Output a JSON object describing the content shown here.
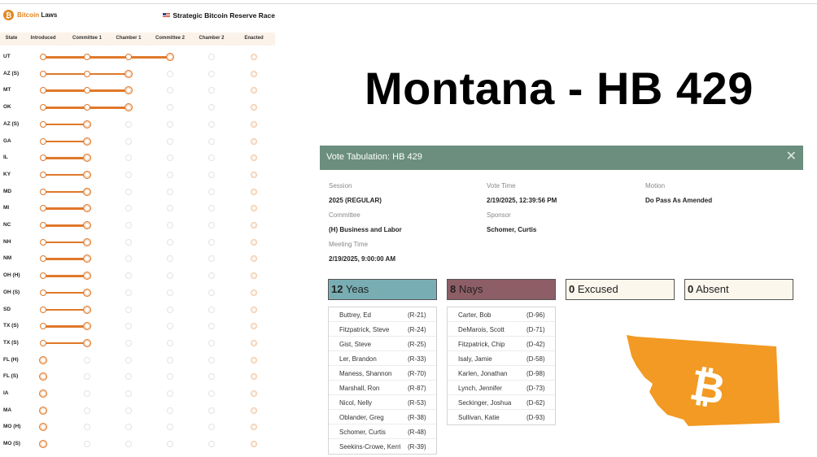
{
  "tracker": {
    "brand": {
      "prefix": "Bitcoin",
      "suffix": " Laws"
    },
    "race_title": "Strategic Bitcoin Reserve Race",
    "columns": [
      "State",
      "Introduced",
      "Committee 1",
      "Chamber 1",
      "Committee 2",
      "Chamber 2",
      "Enacted"
    ],
    "rows": [
      {
        "state": "UT",
        "stage": 3
      },
      {
        "state": "AZ (S)",
        "stage": 2
      },
      {
        "state": "MT",
        "stage": 2
      },
      {
        "state": "OK",
        "stage": 2
      },
      {
        "state": "AZ (S)",
        "stage": 1
      },
      {
        "state": "GA",
        "stage": 1
      },
      {
        "state": "IL",
        "stage": 1
      },
      {
        "state": "KY",
        "stage": 1
      },
      {
        "state": "MD",
        "stage": 1
      },
      {
        "state": "MI",
        "stage": 1
      },
      {
        "state": "NC",
        "stage": 1
      },
      {
        "state": "NH",
        "stage": 1
      },
      {
        "state": "NM",
        "stage": 1
      },
      {
        "state": "OH (H)",
        "stage": 1
      },
      {
        "state": "OH (S)",
        "stage": 1
      },
      {
        "state": "SD",
        "stage": 1
      },
      {
        "state": "TX (S)",
        "stage": 1
      },
      {
        "state": "TX (S)",
        "stage": 1
      },
      {
        "state": "FL (H)",
        "stage": 0
      },
      {
        "state": "FL (S)",
        "stage": 0
      },
      {
        "state": "IA",
        "stage": 0
      },
      {
        "state": "MA",
        "stage": 0
      },
      {
        "state": "MO (H)",
        "stage": 0
      },
      {
        "state": "MO (S)",
        "stage": 0
      }
    ]
  },
  "headline": "Montana - HB 429",
  "vote": {
    "title": "Vote Tabulation: HB 429",
    "close_glyph": "✕",
    "session_label": "Session",
    "session": "2025 (REGULAR)",
    "vote_time_label": "Vote Time",
    "vote_time": "2/19/2025, 12:39:56 PM",
    "motion_label": "Motion",
    "motion": "Do Pass As Amended",
    "committee_label": "Committee",
    "committee": "(H) Business and Labor",
    "sponsor_label": "Sponsor",
    "sponsor": "Schomer, Curtis",
    "meeting_time_label": "Meeting Time",
    "meeting_time": "2/19/2025, 9:00:00 AM",
    "tallies": {
      "yeas": {
        "count": "12",
        "label": "Yeas"
      },
      "nays": {
        "count": "8",
        "label": "Nays"
      },
      "excused": {
        "count": "0",
        "label": "Excused"
      },
      "absent": {
        "count": "0",
        "label": "Absent"
      }
    },
    "yeas": [
      {
        "name": "Buttrey, Ed",
        "party": "(R-21)"
      },
      {
        "name": "Fitzpatrick, Steve",
        "party": "(R-24)"
      },
      {
        "name": "Gist, Steve",
        "party": "(R-25)"
      },
      {
        "name": "Ler, Brandon",
        "party": "(R-33)"
      },
      {
        "name": "Maness, Shannon",
        "party": "(R-70)"
      },
      {
        "name": "Marshall, Ron",
        "party": "(R-87)"
      },
      {
        "name": "Nicol, Nelly",
        "party": "(R-53)"
      },
      {
        "name": "Oblander, Greg",
        "party": "(R-38)"
      },
      {
        "name": "Schomer, Curtis",
        "party": "(R-48)"
      },
      {
        "name": "Seekins-Crowe, Kerri",
        "party": "(R-39)"
      }
    ],
    "nays": [
      {
        "name": "Carter, Bob",
        "party": "(D-96)"
      },
      {
        "name": "DeMarois, Scott",
        "party": "(D-71)"
      },
      {
        "name": "Fitzpatrick, Chip",
        "party": "(D-42)"
      },
      {
        "name": "Isaly, Jamie",
        "party": "(D-58)"
      },
      {
        "name": "Karlen, Jonathan",
        "party": "(D-98)"
      },
      {
        "name": "Lynch, Jennifer",
        "party": "(D-73)"
      },
      {
        "name": "Seckinger, Joshua",
        "party": "(D-62)"
      },
      {
        "name": "Sullivan, Katie",
        "party": "(D-93)"
      }
    ]
  },
  "colors": {
    "accent": "#e0782a",
    "header_green": "#6b8e7e",
    "yeas": "#78aeb3",
    "nays": "#8e5e66",
    "montana": "#f29a23"
  }
}
